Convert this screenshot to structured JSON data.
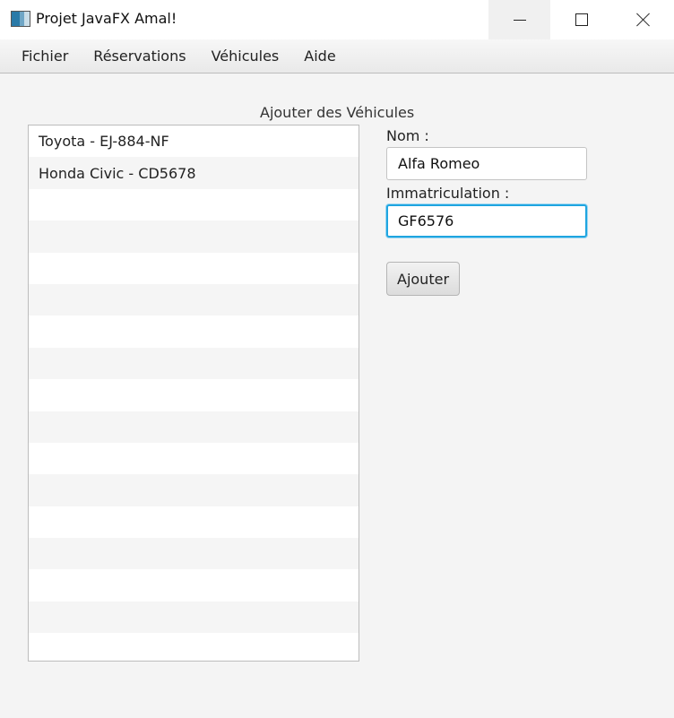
{
  "window": {
    "title": "Projet JavaFX Amal!"
  },
  "menu": [
    "Fichier",
    "Réservations",
    "Véhicules",
    "Aide"
  ],
  "section_title": "Ajouter des Véhicules",
  "vehicles": [
    "Toyota - EJ-884-NF",
    "Honda Civic - CD5678",
    "",
    "",
    "",
    "",
    "",
    "",
    "",
    "",
    "",
    "",
    "",
    "",
    "",
    "",
    ""
  ],
  "form": {
    "nom_label": "Nom :",
    "nom_value": "Alfa Romeo",
    "immat_label": "Immatriculation :",
    "immat_value": "GF6576",
    "add_button": "Ajouter"
  }
}
